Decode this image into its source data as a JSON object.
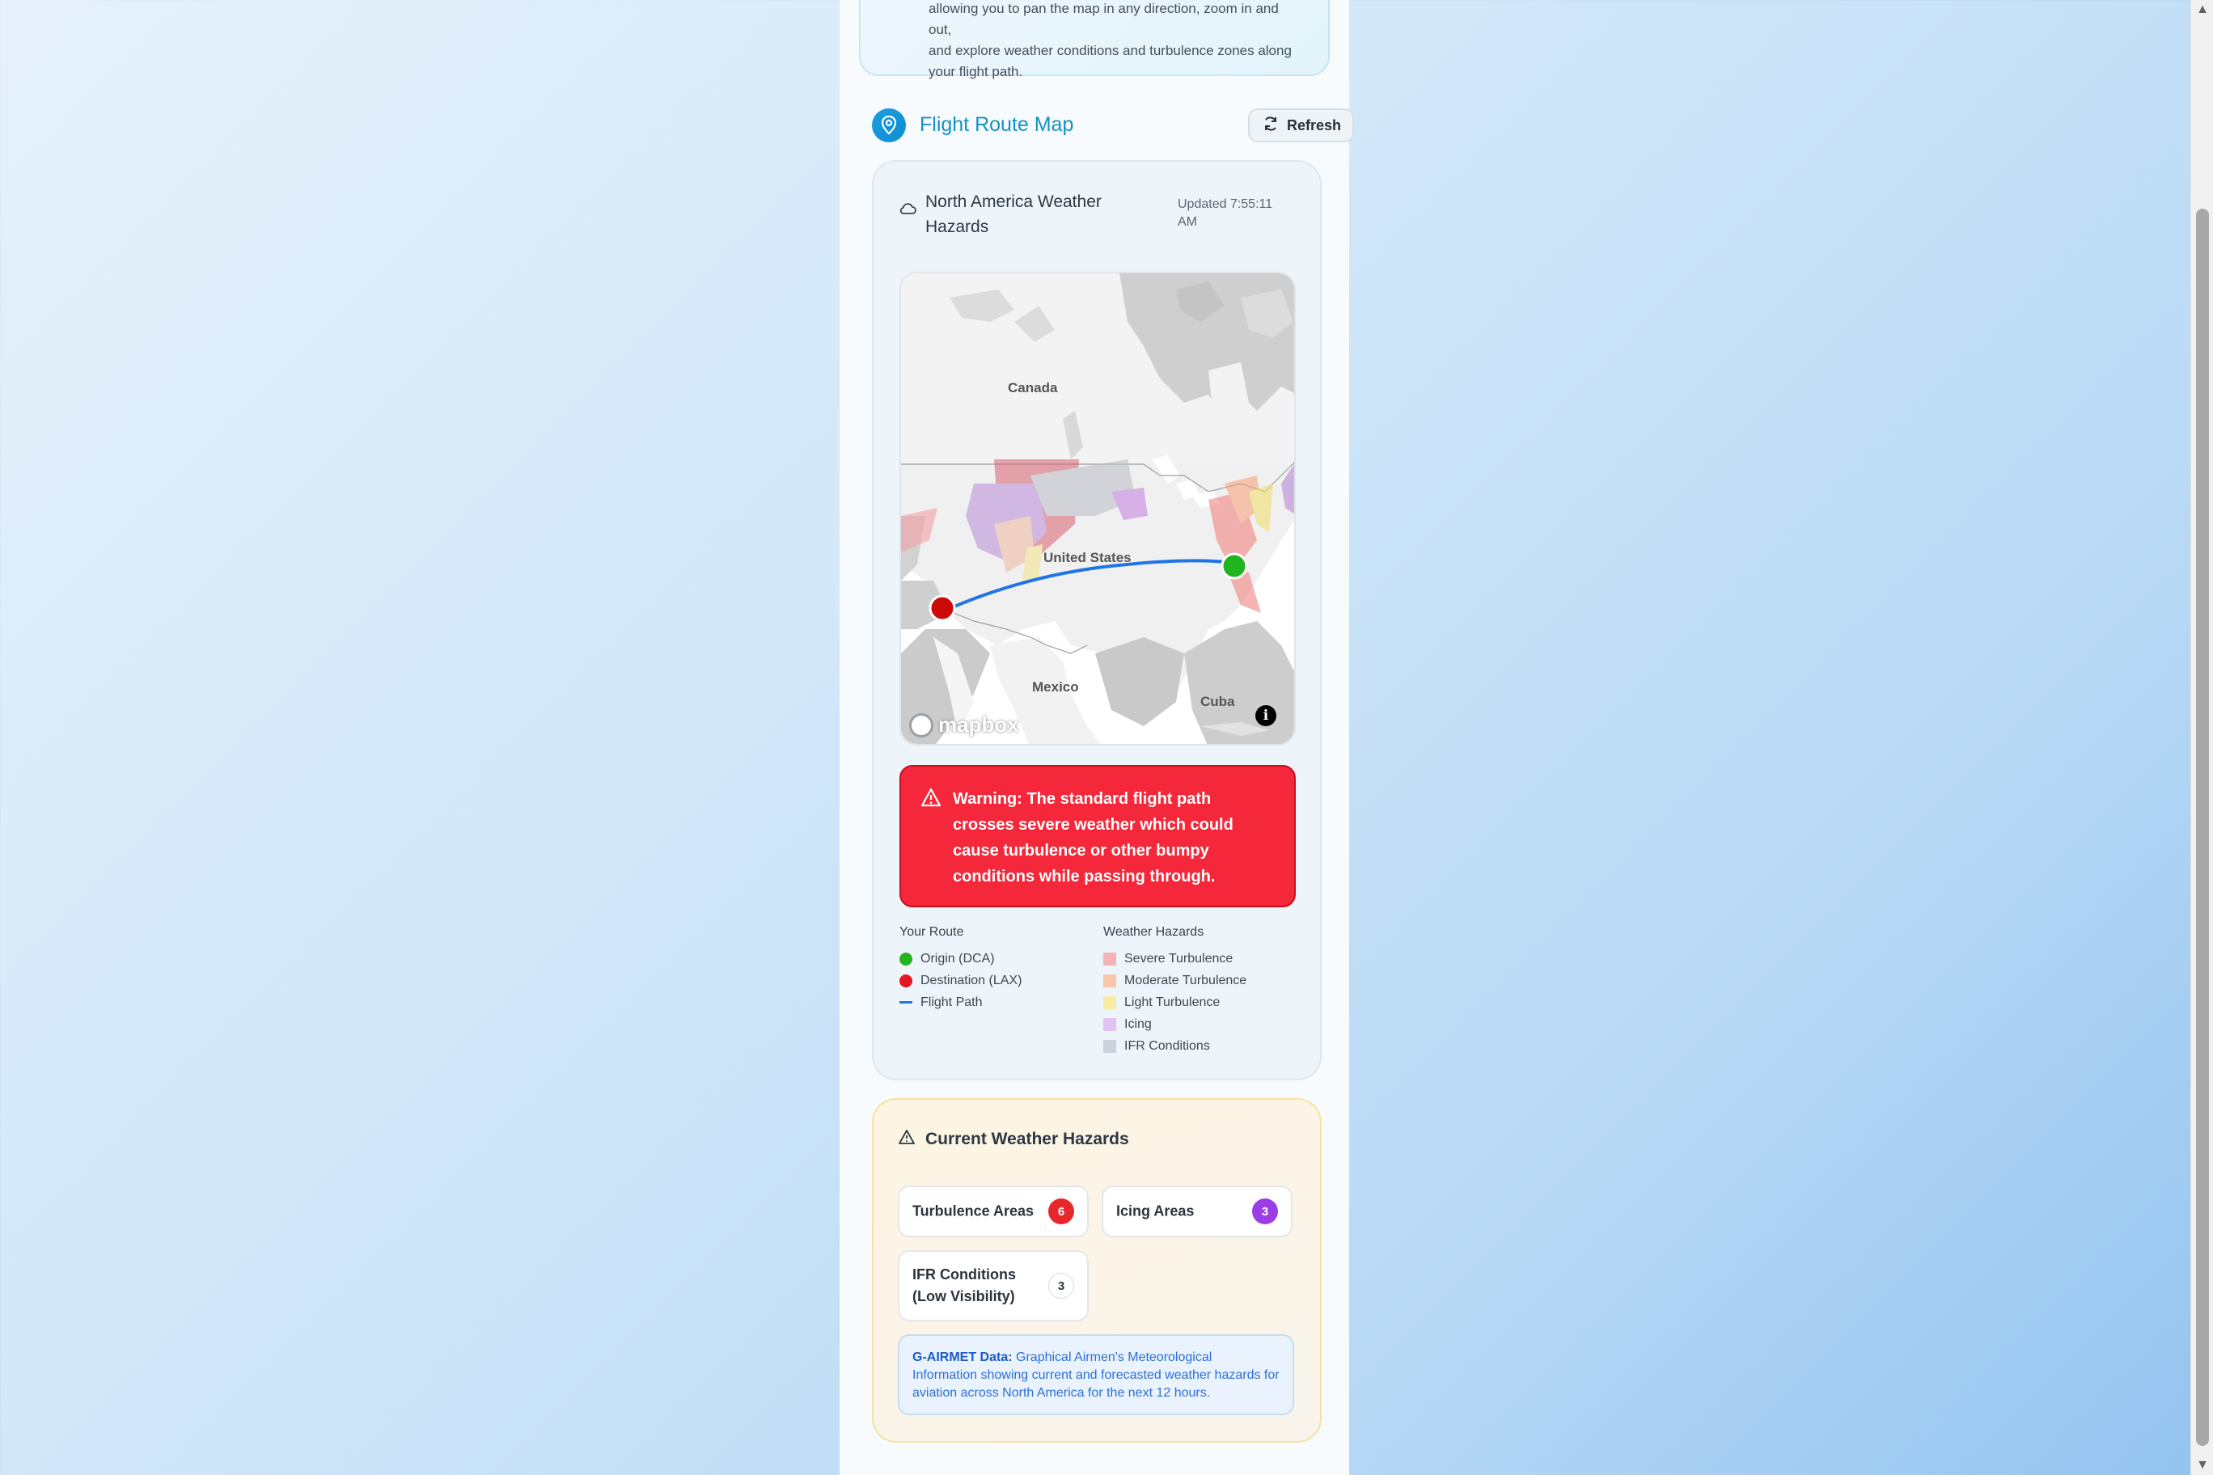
{
  "intro": {
    "text_line1": "allowing you to pan the map in any direction, zoom in and out,",
    "text_line2": "and explore weather conditions and turbulence zones along",
    "text_line3": "your flight path."
  },
  "header": {
    "title": "Flight Route Map",
    "refresh_label": "Refresh",
    "icon": "map-pin-icon"
  },
  "map_panel": {
    "title": "North America Weather Hazards",
    "updated": "Updated 7:55:11 AM",
    "map": {
      "labels": {
        "canada": "Canada",
        "united_states": "United States",
        "mexico": "Mexico",
        "cuba": "Cuba"
      },
      "attribution": "mapbox",
      "origin_color": "#1fb51f",
      "destination_color": "#cc0a0a",
      "route_color": "#1e75e6"
    },
    "warning": "Warning: The standard flight path crosses severe weather which could cause turbulence or other bumpy conditions while passing through."
  },
  "legend": {
    "route": {
      "title": "Your Route",
      "items": [
        {
          "label": "Origin (DCA)",
          "color": "#22b522"
        },
        {
          "label": "Destination (LAX)",
          "color": "#e5161f"
        },
        {
          "label": "Flight Path",
          "color": "#1e75e6"
        }
      ]
    },
    "hazards": {
      "title": "Weather Hazards",
      "items": [
        {
          "label": "Severe Turbulence",
          "color": "#f5b3b8"
        },
        {
          "label": "Moderate Turbulence",
          "color": "#f9c6a8"
        },
        {
          "label": "Light Turbulence",
          "color": "#f8eca3"
        },
        {
          "label": "Icing",
          "color": "#e1c3f2"
        },
        {
          "label": "IFR Conditions",
          "color": "#cbd2dc"
        }
      ]
    }
  },
  "hazards_panel": {
    "title": "Current Weather Hazards",
    "chips": [
      {
        "label": "Turbulence Areas",
        "count": "6",
        "color": "#e8262e"
      },
      {
        "label": "Icing Areas",
        "count": "3",
        "color": "#9b3de6"
      },
      {
        "label_line1": "IFR Conditions",
        "label_line2": "(Low Visibility)",
        "count": "3",
        "color": "#ffffff"
      }
    ],
    "gairmet_title": "G-AIRMET Data:",
    "gairmet_text": "Graphical Airmen's Meteorological Information showing current and forecasted weather hazards for aviation across North America for the next 12 hours."
  }
}
